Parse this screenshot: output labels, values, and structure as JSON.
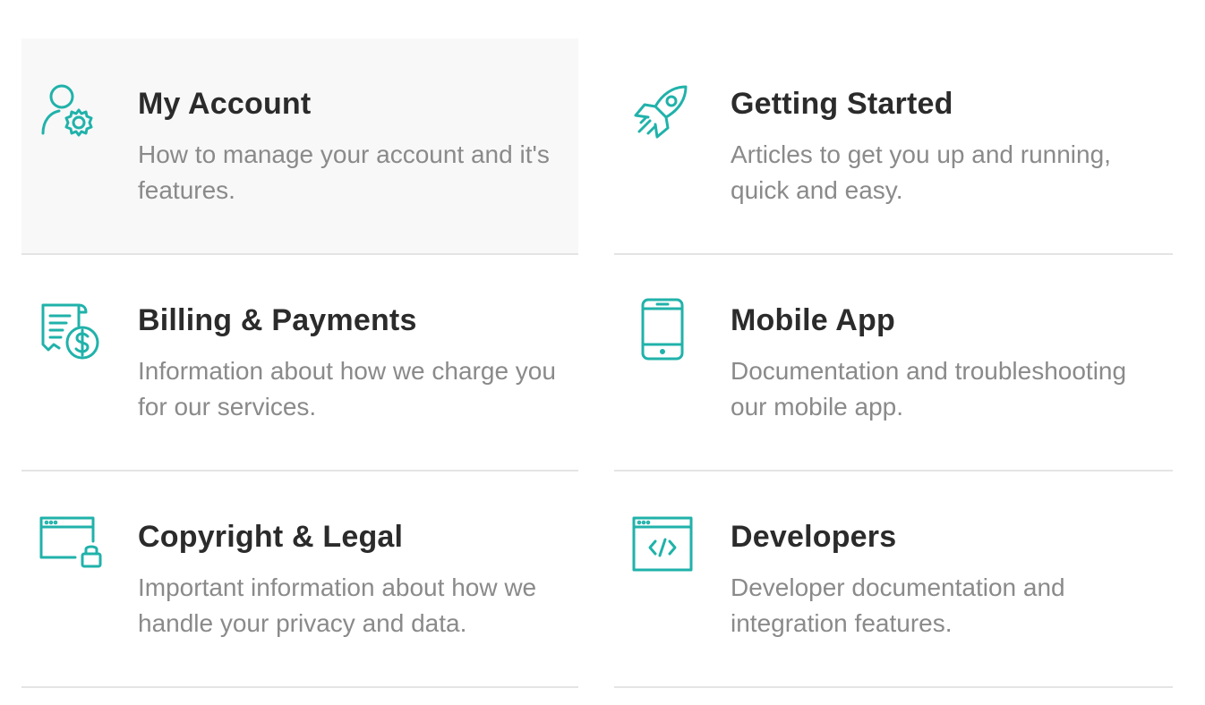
{
  "accent_color": "#20b2aa",
  "cards": [
    {
      "title": "My Account",
      "description": "How to manage your account and it's features.",
      "icon": "user-gear-icon"
    },
    {
      "title": "Getting Started",
      "description": "Articles to get you up and running, quick and easy.",
      "icon": "rocket-icon"
    },
    {
      "title": "Billing & Payments",
      "description": "Information about how we charge you for our services.",
      "icon": "receipt-dollar-icon"
    },
    {
      "title": "Mobile App",
      "description": "Documentation and troubleshooting our mobile app.",
      "icon": "smartphone-icon"
    },
    {
      "title": "Copyright & Legal",
      "description": "Important information about how we handle your privacy and data.",
      "icon": "browser-lock-icon"
    },
    {
      "title": "Developers",
      "description": "Developer documentation and integration features.",
      "icon": "browser-code-icon"
    }
  ]
}
